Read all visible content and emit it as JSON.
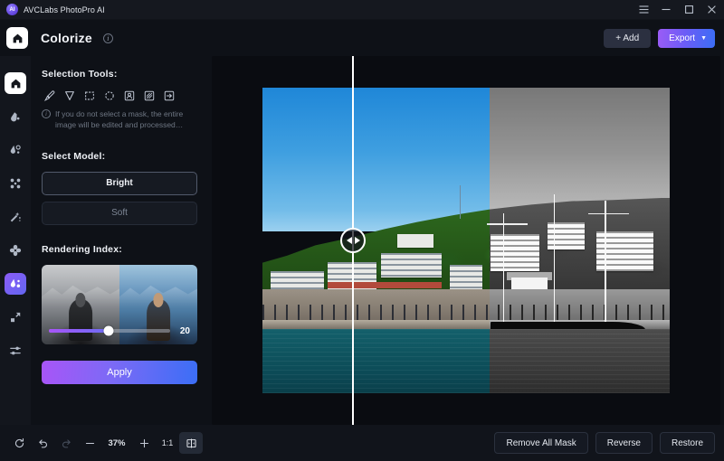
{
  "titlebar": {
    "app_name": "AVCLabs PhotoPro AI",
    "logo_text": "AI",
    "menu_icon": "hamburger-menu-icon",
    "minimize_icon": "minimize-icon",
    "maximize_icon": "maximize-icon",
    "close_icon": "close-icon"
  },
  "header": {
    "home_icon": "home-icon",
    "title": "Colorize",
    "info_icon": "info-icon",
    "add_label": "+ Add",
    "export_label": "Export",
    "export_caret": "chevron-down-icon"
  },
  "rail": {
    "items": [
      {
        "name": "home-icon",
        "active": false
      },
      {
        "name": "retouch-icon",
        "active": false
      },
      {
        "name": "background-remove-icon",
        "active": false
      },
      {
        "name": "enhance-icon",
        "active": false
      },
      {
        "name": "magic-wand-icon",
        "active": false
      },
      {
        "name": "denoise-icon",
        "active": false
      },
      {
        "name": "colorize-icon",
        "active": true
      },
      {
        "name": "upscale-icon",
        "active": false
      },
      {
        "name": "adjust-sliders-icon",
        "active": false
      }
    ]
  },
  "sidebar": {
    "selection_tools_label": "Selection Tools:",
    "tools": [
      "brush-tool-icon",
      "pointer-tool-icon",
      "rectangle-select-icon",
      "ellipse-select-icon",
      "portrait-select-icon",
      "texture-select-icon",
      "import-mask-icon"
    ],
    "hint_text": "If you do not select a mask, the entire image will be edited and processed…",
    "select_model_label": "Select Model:",
    "models": [
      {
        "label": "Bright",
        "selected": true
      },
      {
        "label": "Soft",
        "selected": false
      }
    ],
    "rendering_index_label": "Rendering Index:",
    "rendering_index_value": "20",
    "apply_label": "Apply"
  },
  "canvas": {
    "divider_handle_icon": "drag-handle-arrows-icon",
    "left_label": "original-grayscale-preview",
    "right_label": "colorized-preview"
  },
  "bottombar": {
    "reset_icon": "reset-icon",
    "undo_icon": "undo-icon",
    "redo_icon": "redo-icon",
    "zoom_out_icon": "zoom-out-icon",
    "zoom_level": "37%",
    "zoom_in_icon": "zoom-in-icon",
    "fit_label": "1:1",
    "split_view_icon": "split-view-icon",
    "remove_all_mask_label": "Remove All Mask",
    "reverse_label": "Reverse",
    "restore_label": "Restore"
  },
  "colors": {
    "accent_purple": "#a855f7",
    "accent_blue": "#3b6ef6",
    "panel_bg": "#0e1117",
    "rail_bg": "#13161d",
    "canvas_bg": "#0a0c11"
  }
}
